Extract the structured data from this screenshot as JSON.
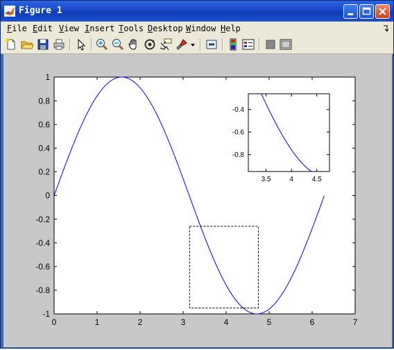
{
  "window": {
    "title": "Figure 1",
    "colors": {
      "titlebar": "#1a48c8",
      "chrome": "#ece9d8",
      "figure_bg": "#c8c8c8",
      "curve": "#0000ff"
    }
  },
  "menu": [
    {
      "key": "F",
      "rest": "ile"
    },
    {
      "key": "E",
      "rest": "dit"
    },
    {
      "key": "V",
      "rest": "iew"
    },
    {
      "key": "I",
      "rest": "nsert"
    },
    {
      "key": "T",
      "rest": "ools"
    },
    {
      "key": "D",
      "rest": "esktop"
    },
    {
      "key": "W",
      "rest": "indow"
    },
    {
      "key": "H",
      "rest": "elp"
    }
  ],
  "toolbar_icons": [
    "new-figure-icon",
    "open-file-icon",
    "save-icon",
    "print-icon",
    "edit-plot-arrow-icon",
    "zoom-in-icon",
    "zoom-out-icon",
    "pan-hand-icon",
    "rotate-3d-icon",
    "data-cursor-icon",
    "brush-icon",
    "brush-dropdown-icon",
    "link-plot-icon",
    "colorbar-icon",
    "legend-icon",
    "hide-plot-tools-icon",
    "show-plot-tools-icon"
  ],
  "chart_data": [
    {
      "type": "line",
      "function": "sin(x)",
      "x_range": [
        0,
        6.28
      ],
      "xlim": [
        0,
        7
      ],
      "ylim": [
        -1,
        1
      ],
      "xticks": [
        "0",
        "1",
        "2",
        "3",
        "4",
        "5",
        "6",
        "7"
      ],
      "yticks": [
        "-1",
        "-0.8",
        "-0.6",
        "-0.4",
        "-0.2",
        "0",
        "0.2",
        "0.4",
        "0.6",
        "0.8",
        "1"
      ],
      "zoom_box": {
        "x": [
          3.15,
          4.75
        ],
        "y": [
          -0.95,
          -0.26
        ]
      },
      "grid": false,
      "title": "",
      "xlabel": "",
      "ylabel": ""
    },
    {
      "type": "line",
      "function": "sin(x)",
      "xlim": [
        3.15,
        4.75
      ],
      "ylim": [
        -0.95,
        -0.26
      ],
      "xticks": [
        "3.5",
        "4",
        "4.5"
      ],
      "yticks": [
        "-0.4",
        "-0.6",
        "-0.8"
      ],
      "grid": false,
      "title": "",
      "xlabel": "",
      "ylabel": ""
    }
  ]
}
